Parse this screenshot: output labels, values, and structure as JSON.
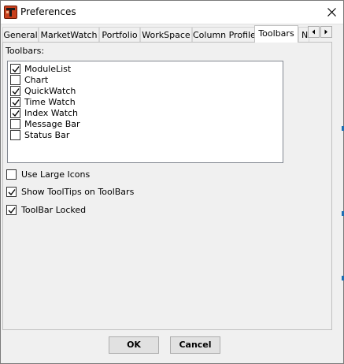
{
  "window": {
    "title": "Preferences",
    "app_icon": "app-logo-t-icon",
    "close_icon": "close-icon"
  },
  "tabs": [
    {
      "label": "General",
      "active": false
    },
    {
      "label": "MarketWatch",
      "active": false
    },
    {
      "label": "Portfolio",
      "active": false
    },
    {
      "label": "WorkSpace",
      "active": false
    },
    {
      "label": "Column Profile",
      "active": false
    },
    {
      "label": "Toolbars",
      "active": true
    },
    {
      "label": "N",
      "active": false
    }
  ],
  "tab_scroll": {
    "left_icon": "arrow-left-icon",
    "right_icon": "arrow-right-icon"
  },
  "toolbars_group": {
    "label": "Toolbars:",
    "items": [
      {
        "label": "ModuleList",
        "checked": true
      },
      {
        "label": "Chart",
        "checked": false
      },
      {
        "label": "QuickWatch",
        "checked": true
      },
      {
        "label": "Time Watch",
        "checked": true
      },
      {
        "label": "Index Watch",
        "checked": true
      },
      {
        "label": "Message Bar",
        "checked": false
      },
      {
        "label": "Status Bar",
        "checked": false
      }
    ]
  },
  "options": [
    {
      "label": "Use Large Icons",
      "checked": false
    },
    {
      "label": "Show ToolTips on ToolBars",
      "checked": true
    },
    {
      "label": "ToolBar Locked",
      "checked": true
    }
  ],
  "buttons": {
    "ok": "OK",
    "cancel": "Cancel"
  }
}
